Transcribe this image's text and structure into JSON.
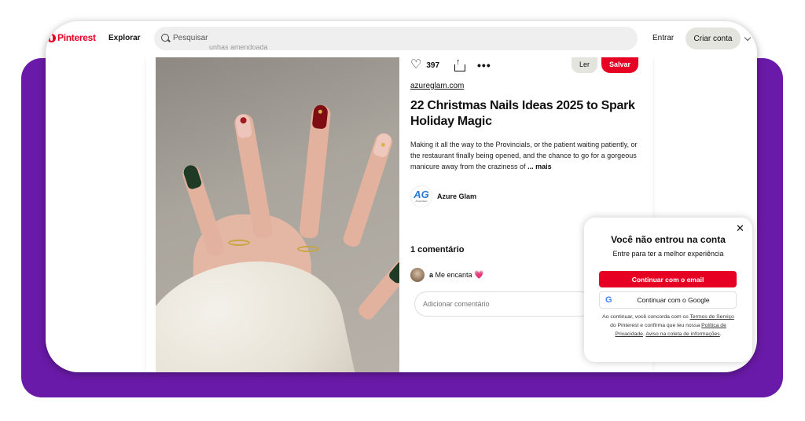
{
  "header": {
    "logo": "Pinterest",
    "nav_explorar": "Explorar",
    "search_placeholder": "Pesquisar",
    "search_ghost": "unhas amendoada",
    "entrar": "Entrar",
    "criar_conta": "Criar conta"
  },
  "pin": {
    "likes": "397",
    "ler_label": "Ler",
    "salvar_label": "Salvar",
    "source": "azureglam.com",
    "title": "22 Christmas Nails Ideas 2025 to Spark Holiday Magic",
    "description": "Making it all the way to the Provincials, or the patient waiting patiently, or the restaurant finally being opened, and the chance to go for a gorgeous manicure away from the craziness of",
    "more": "... mais",
    "author": {
      "avatar_text": "AG",
      "avatar_sub": "AzureGlam",
      "name": "Azure Glam"
    }
  },
  "comments": {
    "title": "1 comentário",
    "items": [
      {
        "user": "a",
        "text": "Me encanta",
        "emoji": "💗"
      }
    ],
    "input_placeholder": "Adicionar comentário"
  },
  "login_popup": {
    "title": "Você não entrou na conta",
    "subtitle": "Entre para ter a melhor experiência",
    "email_button": "Continuar com o email",
    "google_button": "Continuar com o Google",
    "google_letter": "G",
    "terms": {
      "t1": "Ao continuar, você concorda com os ",
      "link1": "Termos de Serviço",
      "t2": " do Pinterest e confirma que leu nossa ",
      "link2": "Política de Privacidade",
      "t3": ". ",
      "link3": "Aviso na coleta de informações",
      "t4": "."
    }
  },
  "colors": {
    "brand": "#e60023",
    "frame": "#6a1aa8"
  },
  "icons": [
    "search-icon",
    "heart-icon",
    "share-icon",
    "more-icon",
    "close-icon",
    "google-icon",
    "chevron-down-icon"
  ]
}
